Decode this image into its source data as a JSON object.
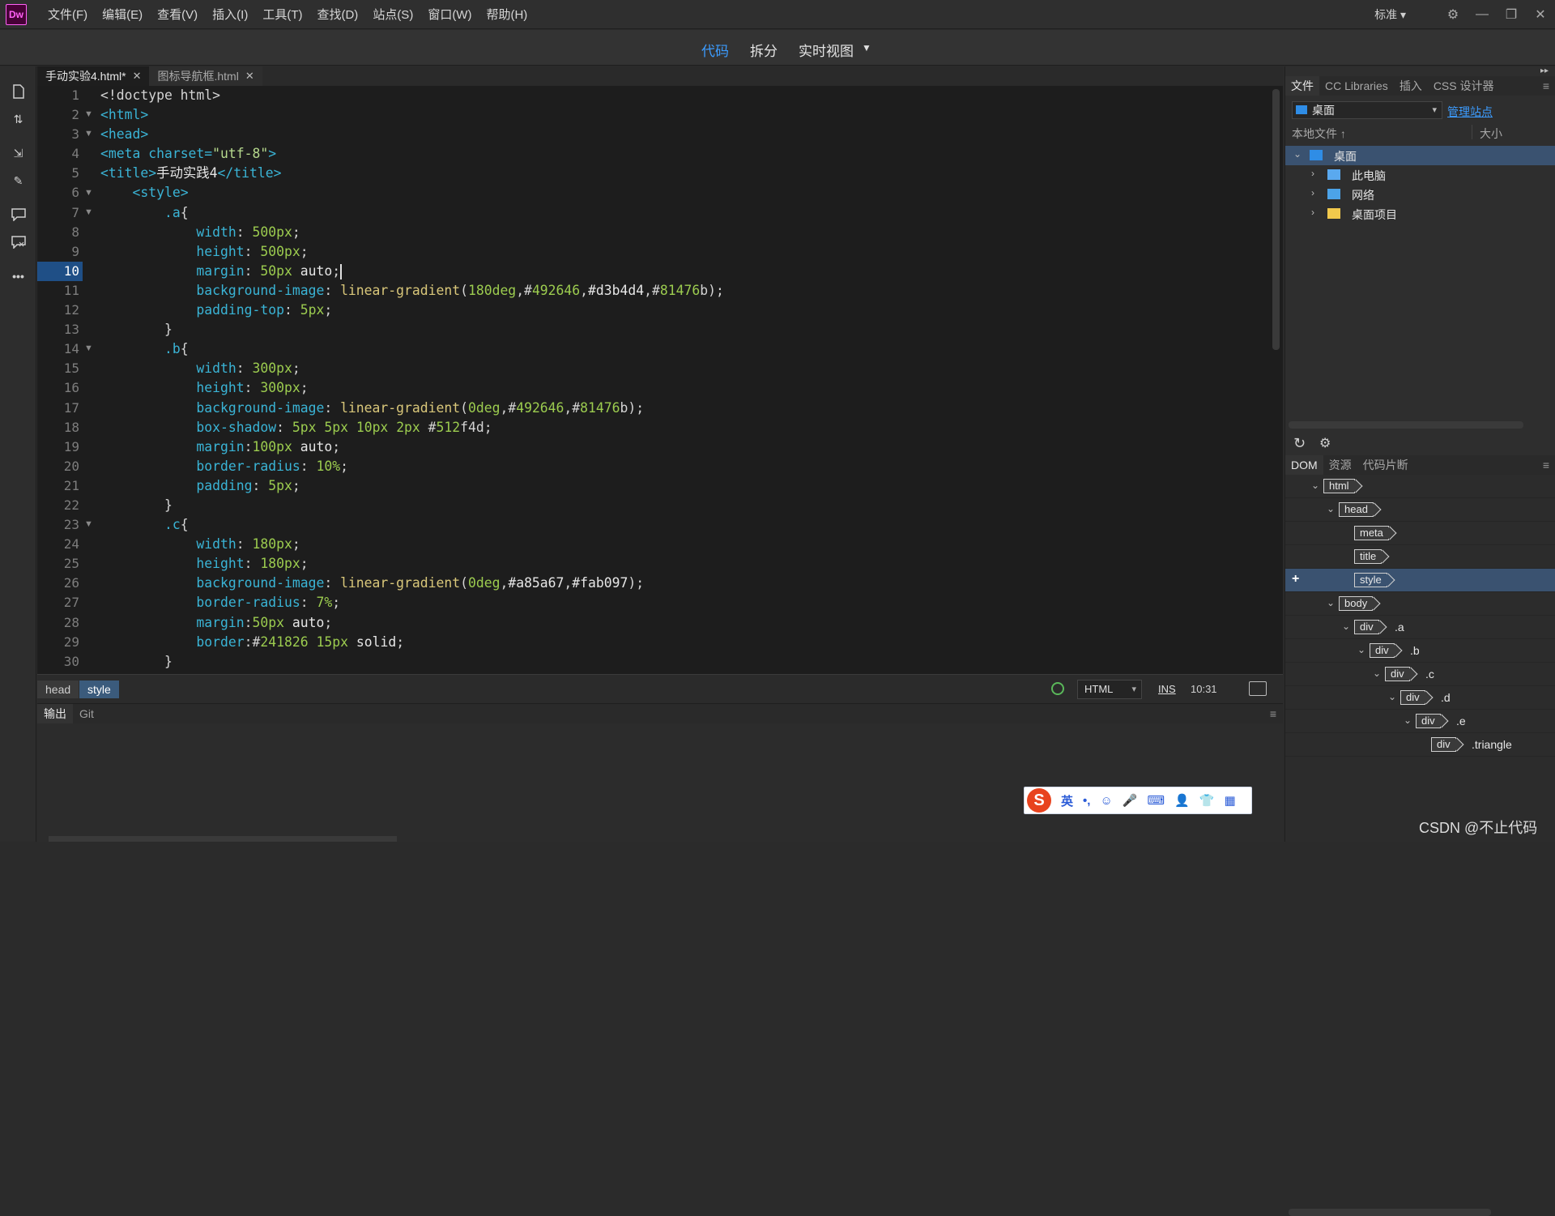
{
  "app": {
    "logo": "Dw"
  },
  "menu": [
    "文件(F)",
    "编辑(E)",
    "查看(V)",
    "插入(I)",
    "工具(T)",
    "查找(D)",
    "站点(S)",
    "窗口(W)",
    "帮助(H)"
  ],
  "workspace": {
    "label": "标准",
    "dropdown_icon": "chevron-down-icon"
  },
  "window_controls": {
    "minimize": "—",
    "restore": "❐",
    "close": "✕"
  },
  "view_tabs": {
    "code": "代码",
    "split": "拆分",
    "live": "实时视图",
    "active": "code"
  },
  "document_tabs": [
    {
      "title": "手动实验4.html*",
      "active": true
    },
    {
      "title": "图标导航框.html",
      "active": false
    }
  ],
  "editor": {
    "current_line": 10,
    "lines": [
      "<!doctype html>",
      "<html>",
      "<head>",
      "<meta charset=\"utf-8\">",
      "<title>手动实践4</title>",
      "    <style>",
      "        .a{",
      "            width: 500px;",
      "            height: 500px;",
      "            margin: 50px auto;",
      "            background-image: linear-gradient(180deg,#492646,#d3b4d4,#81476b);",
      "            padding-top: 5px;",
      "        }",
      "        .b{",
      "            width: 300px;",
      "            height: 300px;",
      "            background-image: linear-gradient(0deg,#492646,#81476b);",
      "            box-shadow: 5px 5px 10px 2px #512f4d;",
      "            margin:100px auto;",
      "            border-radius: 10%;",
      "            padding: 5px;",
      "        }",
      "        .c{",
      "            width: 180px;",
      "            height: 180px;",
      "            background-image: linear-gradient(0deg,#a85a67,#fab097);",
      "            border-radius: 7%;",
      "            margin:50px auto;",
      "            border:#241826 15px solid;",
      "        }"
    ],
    "folded_lines": [
      2,
      3,
      6,
      7,
      14,
      23
    ]
  },
  "status": {
    "breadcrumbs": [
      "head",
      "style"
    ],
    "language": "HTML",
    "mode": "INS",
    "cursor": "10:31"
  },
  "output_tabs": [
    "输出",
    "Git"
  ],
  "files_panel": {
    "tabs": [
      "文件",
      "CC Libraries",
      "插入",
      "CSS 设计器"
    ],
    "site": "桌面",
    "manage_site": "管理站点",
    "col_local": "本地文件 ↑",
    "col_size": "大小",
    "tree": [
      {
        "label": "桌面",
        "level": 0,
        "selected": true,
        "expanded": true,
        "icon": "desktop-icon"
      },
      {
        "label": "此电脑",
        "level": 1,
        "icon": "computer-icon"
      },
      {
        "label": "网络",
        "level": 1,
        "icon": "network-icon"
      },
      {
        "label": "桌面项目",
        "level": 1,
        "icon": "folder-icon"
      }
    ]
  },
  "dom_panel": {
    "tabs": [
      "DOM",
      "资源",
      "代码片断"
    ],
    "nodes": [
      {
        "tag": "html",
        "cls": "",
        "level": 0,
        "chev": true
      },
      {
        "tag": "head",
        "cls": "",
        "level": 1,
        "chev": true
      },
      {
        "tag": "meta",
        "cls": "",
        "level": 2,
        "chev": false
      },
      {
        "tag": "title",
        "cls": "",
        "level": 2,
        "chev": false
      },
      {
        "tag": "style",
        "cls": "",
        "level": 2,
        "chev": false,
        "selected": true
      },
      {
        "tag": "body",
        "cls": "",
        "level": 1,
        "chev": true
      },
      {
        "tag": "div",
        "cls": ".a",
        "level": 2,
        "chev": true
      },
      {
        "tag": "div",
        "cls": ".b",
        "level": 3,
        "chev": true
      },
      {
        "tag": "div",
        "cls": ".c",
        "level": 4,
        "chev": true
      },
      {
        "tag": "div",
        "cls": ".d",
        "level": 5,
        "chev": true
      },
      {
        "tag": "div",
        "cls": ".e",
        "level": 6,
        "chev": true
      },
      {
        "tag": "div",
        "cls": ".triangle",
        "level": 7,
        "chev": false
      }
    ]
  },
  "ime": {
    "logo": "S",
    "items": [
      "英",
      "•,",
      "☺",
      "🎤",
      "⌨",
      "👤",
      "👕",
      "▦"
    ]
  },
  "watermark": "CSDN @不止代码"
}
